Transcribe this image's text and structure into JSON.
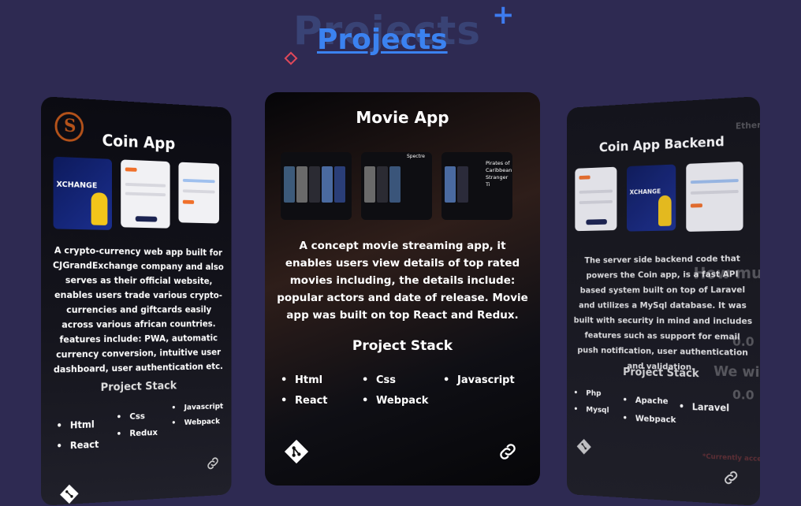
{
  "section": {
    "title": "Projects"
  },
  "cards": {
    "left": {
      "title": "Coin App",
      "thumb_text": "XCHANGE",
      "description": "A crypto-currency web app built for CJGrandExchange company and also serves as their official website, enables users trade various crypto-currencies and giftcards easily across various african countries. features include: PWA, automatic currency conversion, intuitive user dashboard, user authentication etc.",
      "stack_title": "Project Stack",
      "stack": [
        "Html",
        "React",
        "Css",
        "Redux",
        "Javascript",
        "Webpack"
      ]
    },
    "center": {
      "title": "Movie App",
      "thumb_text": "Spectre",
      "thumb_text_2": "Pirates of Caribbean Stranger Ti",
      "description": "A concept movie streaming app, it enables users view details of top rated movies including, the details include: popular actors and date of release. Movie app was built on top React and Redux.",
      "stack_title": "Project Stack",
      "stack": [
        "Html",
        "React",
        "Css",
        "Webpack",
        "Javascript"
      ]
    },
    "right": {
      "title": "Coin App Backend",
      "thumb_text": "XCHANGE",
      "description": "The server side backend code that powers the Coin app, is a fast API based system built on top of Laravel and utilizes a MySql database. It was built with security in mind and includes features such as support for email push notification, user authentication and validation.",
      "stack_title": "Project Stack",
      "stack": [
        "Php",
        "Mysql",
        "Apache",
        "Webpack",
        "Laravel"
      ],
      "overlay_1": "How much bi",
      "overlay_2": "We will p",
      "overlay_3": "0.0",
      "overlay_4": "0.0",
      "overlay_5": "Ethere",
      "overlay_6": "*Currently accep"
    }
  },
  "icons": {
    "git": "git-icon",
    "link": "link-icon"
  },
  "colors": {
    "background": "#2e2a52",
    "title": "#3b82f0",
    "accent_red": "#e0485a"
  }
}
